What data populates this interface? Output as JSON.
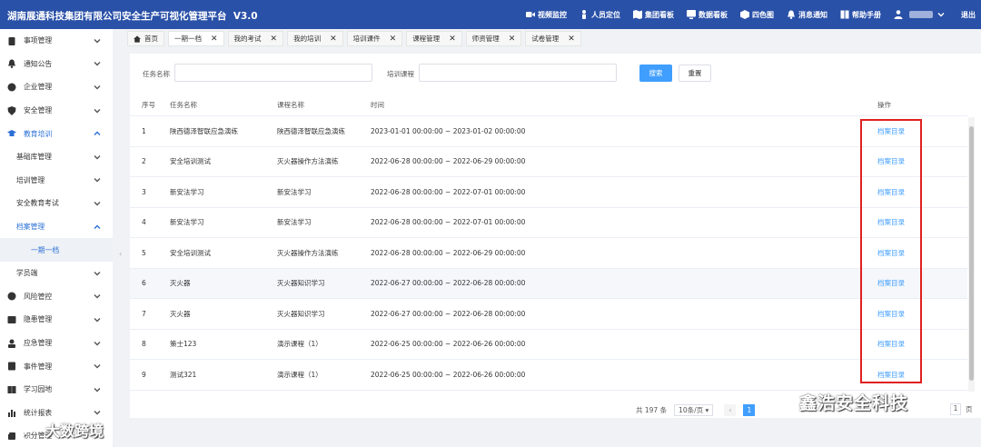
{
  "header": {
    "title": "湖南展通科技集团有限公司安全生产可视化管理平台",
    "version": "V3.0",
    "nav": [
      {
        "label": "视频监控",
        "icon": "video-camera-icon"
      },
      {
        "label": "人员定位",
        "icon": "person-icon"
      },
      {
        "label": "集团看板",
        "icon": "map-icon"
      },
      {
        "label": "数据看板",
        "icon": "data-board-icon"
      },
      {
        "label": "四色图",
        "icon": "four-color-icon"
      },
      {
        "label": "消息通知",
        "icon": "bell-icon"
      },
      {
        "label": "帮助手册",
        "icon": "book-icon"
      }
    ],
    "user_icon": "user-icon",
    "logout": "退出"
  },
  "sidebar": {
    "items": [
      {
        "label": "事项管理",
        "icon": "clipboard-icon"
      },
      {
        "label": "通知公告",
        "icon": "bell-icon"
      },
      {
        "label": "企业管理",
        "icon": "building-icon"
      },
      {
        "label": "安全管理",
        "icon": "shield-icon"
      },
      {
        "label": "教育培训",
        "icon": "graduation-cap-icon"
      },
      {
        "label": "基础库管理"
      },
      {
        "label": "培训管理"
      },
      {
        "label": "安全教育考试"
      },
      {
        "label": "档案管理"
      },
      {
        "label": "一期一档"
      },
      {
        "label": "学员端"
      },
      {
        "label": "风险管控",
        "icon": "risk-icon"
      },
      {
        "label": "隐患管理",
        "icon": "hazard-icon"
      },
      {
        "label": "应急管理",
        "icon": "emergency-icon"
      },
      {
        "label": "事件管理",
        "icon": "event-icon"
      },
      {
        "label": "学习园地",
        "icon": "study-icon"
      },
      {
        "label": "统计报表",
        "icon": "chart-icon"
      },
      {
        "label": "积分管理",
        "icon": "points-icon"
      }
    ]
  },
  "tabs": [
    {
      "label": "首页"
    },
    {
      "label": "一期一档"
    },
    {
      "label": "我的考试"
    },
    {
      "label": "我的培训"
    },
    {
      "label": "培训课件"
    },
    {
      "label": "课程管理"
    },
    {
      "label": "师资管理"
    },
    {
      "label": "试卷管理"
    }
  ],
  "search": {
    "task_label": "任务名称",
    "course_label": "培训课程",
    "task_value": "",
    "course_value": "",
    "search_button": "搜索",
    "reset_button": "重置"
  },
  "table": {
    "headers": {
      "no": "序号",
      "task": "任务名称",
      "course": "课程名称",
      "time": "时间",
      "op": "操作"
    },
    "rows": [
      {
        "no": "1",
        "task": "陕西德泽智联应急演练",
        "course": "陕西德泽智联应急演练",
        "time": "2023-01-01 00:00:00 ~ 2023-01-02 00:00:00",
        "op": "档案目录"
      },
      {
        "no": "2",
        "task": "安全培训测试",
        "course": "灭火器操作方法演练",
        "time": "2022-06-28 00:00:00 ~ 2022-06-29 00:00:00",
        "op": "档案目录"
      },
      {
        "no": "3",
        "task": "新安法学习",
        "course": "新安法学习",
        "time": "2022-06-28 00:00:00 ~ 2022-07-01 00:00:00",
        "op": "档案目录"
      },
      {
        "no": "4",
        "task": "新安法学习",
        "course": "新安法学习",
        "time": "2022-06-28 00:00:00 ~ 2022-07-01 00:00:00",
        "op": "档案目录"
      },
      {
        "no": "5",
        "task": "安全培训测试",
        "course": "灭火器操作方法演练",
        "time": "2022-06-28 00:00:00 ~ 2022-06-29 00:00:00",
        "op": "档案目录"
      },
      {
        "no": "6",
        "task": "灭火器",
        "course": "灭火器知识学习",
        "time": "2022-06-27 00:00:00 ~ 2022-06-28 00:00:00",
        "op": "档案目录"
      },
      {
        "no": "7",
        "task": "灭火器",
        "course": "灭火器知识学习",
        "time": "2022-06-27 00:00:00 ~ 2022-06-28 00:00:00",
        "op": "档案目录"
      },
      {
        "no": "8",
        "task": "策士123",
        "course": "演示课程（1）",
        "time": "2022-06-25 00:00:00 ~ 2022-06-26 00:00:00",
        "op": "档案目录"
      },
      {
        "no": "9",
        "task": "测试321",
        "course": "演示课程（1）",
        "time": "2022-06-25 00:00:00 ~ 2022-06-26 00:00:00",
        "op": "档案目录"
      }
    ]
  },
  "pagination": {
    "total": "共 197 条",
    "page_size": "10条/页",
    "current": "1",
    "goto": "1",
    "page_suffix": "页"
  },
  "watermarks": {
    "right": "鑫浩安全科技",
    "left": "大数跨境"
  }
}
